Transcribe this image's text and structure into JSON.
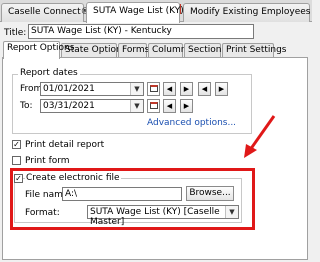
{
  "doc_tabs": [
    {
      "label": "Caselle Connect®"
    },
    {
      "label": "SUTA Wage List (KY)"
    },
    {
      "label": "Modify Existing Employees"
    }
  ],
  "title": {
    "label": "Title:",
    "value": "SUTA Wage List (KY) - Kentucky"
  },
  "section_tabs": [
    {
      "label": "Report Options"
    },
    {
      "label": "State Options"
    },
    {
      "label": "Forms"
    },
    {
      "label": "Columns"
    },
    {
      "label": "Sections"
    },
    {
      "label": "Print Settings"
    }
  ],
  "report_dates": {
    "legend": "Report dates",
    "from_label": "From:",
    "from_value": "01/01/2021",
    "to_label": "To:",
    "to_value": "03/31/2021",
    "advanced_link": "Advanced options..."
  },
  "print_detail": {
    "label": "Print detail report",
    "checked": true
  },
  "print_form": {
    "label": "Print form",
    "checked": false
  },
  "electronic_file": {
    "label": "Create electronic file",
    "checked": true,
    "file_name_label": "File name:",
    "file_name_value": "A:\\",
    "browse_label": "Browse...",
    "format_label": "Format:",
    "format_value": "SUTA Wage List (KY) [Caselle Master]"
  },
  "colors": {
    "highlight": "#e01818",
    "link": "#1a4fb0"
  },
  "icons": [
    "calendar-icon",
    "arrow-left-icon",
    "arrow-right-icon",
    "dropdown-arrow-icon",
    "close-icon",
    "annotation-arrow"
  ]
}
